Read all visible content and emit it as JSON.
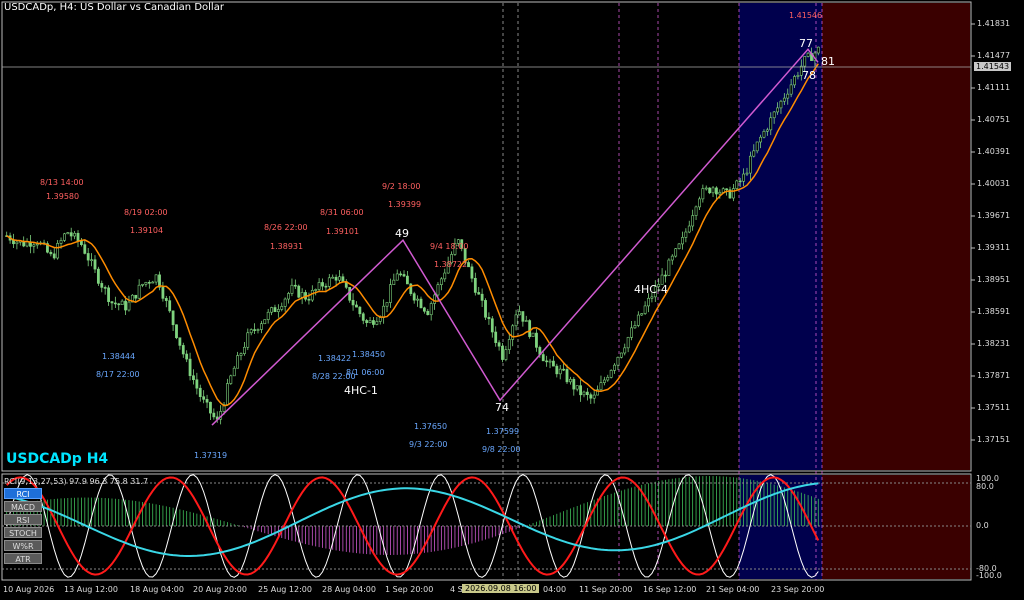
{
  "header": {
    "title": "USDCADp, H4:  US Dollar vs Canadian Dollar"
  },
  "watermark": "USDCADp H4",
  "current_price": "1.41543",
  "top_label": "1.41546",
  "price_axis": [
    "1.41831",
    "1.41477",
    "1.41111",
    "1.40751",
    "1.40391",
    "1.40031",
    "1.39671",
    "1.39311",
    "1.38951",
    "1.38591",
    "1.38231",
    "1.37871",
    "1.37511",
    "1.37151"
  ],
  "time_axis": [
    "10 Aug 2026",
    "13 Aug 12:00",
    "18 Aug 04:00",
    "20 Aug 20:00",
    "25 Aug 12:00",
    "28 Aug 04:00",
    "1 Sep 20:00",
    "4 S",
    "04:00",
    "11 Sep 20:00",
    "16 Sep 12:00",
    "21 Sep 04:00",
    "23 Sep 20:00"
  ],
  "crosshair_time": "2026.09.08 16:00",
  "annotations_red": [
    {
      "date": "8/13 14:00",
      "price": "1.39580"
    },
    {
      "date": "8/19 02:00",
      "price": "1.39104"
    },
    {
      "date": "8/26 22:00",
      "price": "1.38931"
    },
    {
      "date": "8/31 06:00",
      "price": "1.39101"
    },
    {
      "date": "9/2 18:00",
      "price": "1.39399"
    },
    {
      "date": "9/4 18:00",
      "price": "1.38722"
    }
  ],
  "annotations_blue": [
    {
      "price": "1.38444",
      "date": "8/17 22:00"
    },
    {
      "price": "1.38422",
      "date": "8/28 22:00"
    },
    {
      "price": "1.38450",
      "date": "8/1 06:00"
    },
    {
      "price": "1.37319",
      "date": ""
    },
    {
      "price": "1.37650",
      "date": "9/3 22:00"
    },
    {
      "price": "1.37599",
      "date": "9/8 22:00"
    }
  ],
  "wave_labels": {
    "p1": "49",
    "p2": "74",
    "p3": "77",
    "p4": "78",
    "p5": "81"
  },
  "pattern_labels": {
    "hc1": "4HC-1",
    "hc4": "4HC-4"
  },
  "rci": {
    "title": "RCI(9,13,27,53) 97.9 96.3 75.8 31.7",
    "axis": [
      "100.0",
      "80.0",
      "0.0",
      "-80.0",
      "-100.0"
    ]
  },
  "indicator_buttons": [
    "RCI",
    "MACD",
    "RSI",
    "STOCH",
    "W%R",
    "ATR"
  ],
  "colors": {
    "ma": "#ff8c00",
    "zigzag": "#d05ad0",
    "highlight_blue": "#00004d",
    "highlight_red": "#3a0000",
    "rci_white": "#ffffff",
    "rci_red": "#ff1a1a",
    "rci_cyan": "#3ad7e6",
    "histogram_green": "#3fbf5a",
    "histogram_magenta": "#d05ad0",
    "accent": "#1e6fd9"
  },
  "chart_data": {
    "type": "candlestick",
    "series": [
      {
        "name": "price_path",
        "values": [
          1.3945,
          1.3936,
          1.394,
          1.392,
          1.395,
          1.3935,
          1.39,
          1.387,
          1.3865,
          1.389,
          1.39,
          1.385,
          1.38,
          1.376,
          1.3735,
          1.379,
          1.383,
          1.385,
          1.3865,
          1.3885,
          1.3875,
          1.389,
          1.39,
          1.387,
          1.3845,
          1.386,
          1.3905,
          1.388,
          1.386,
          1.39,
          1.394,
          1.3895,
          1.385,
          1.381,
          1.3865,
          1.383,
          1.38,
          1.379,
          1.377,
          1.376,
          1.379,
          1.382,
          1.385,
          1.388,
          1.391,
          1.394,
          1.399,
          1.4,
          1.399,
          1.401,
          1.405,
          1.408,
          1.411,
          1.414,
          1.4154
        ]
      }
    ]
  }
}
